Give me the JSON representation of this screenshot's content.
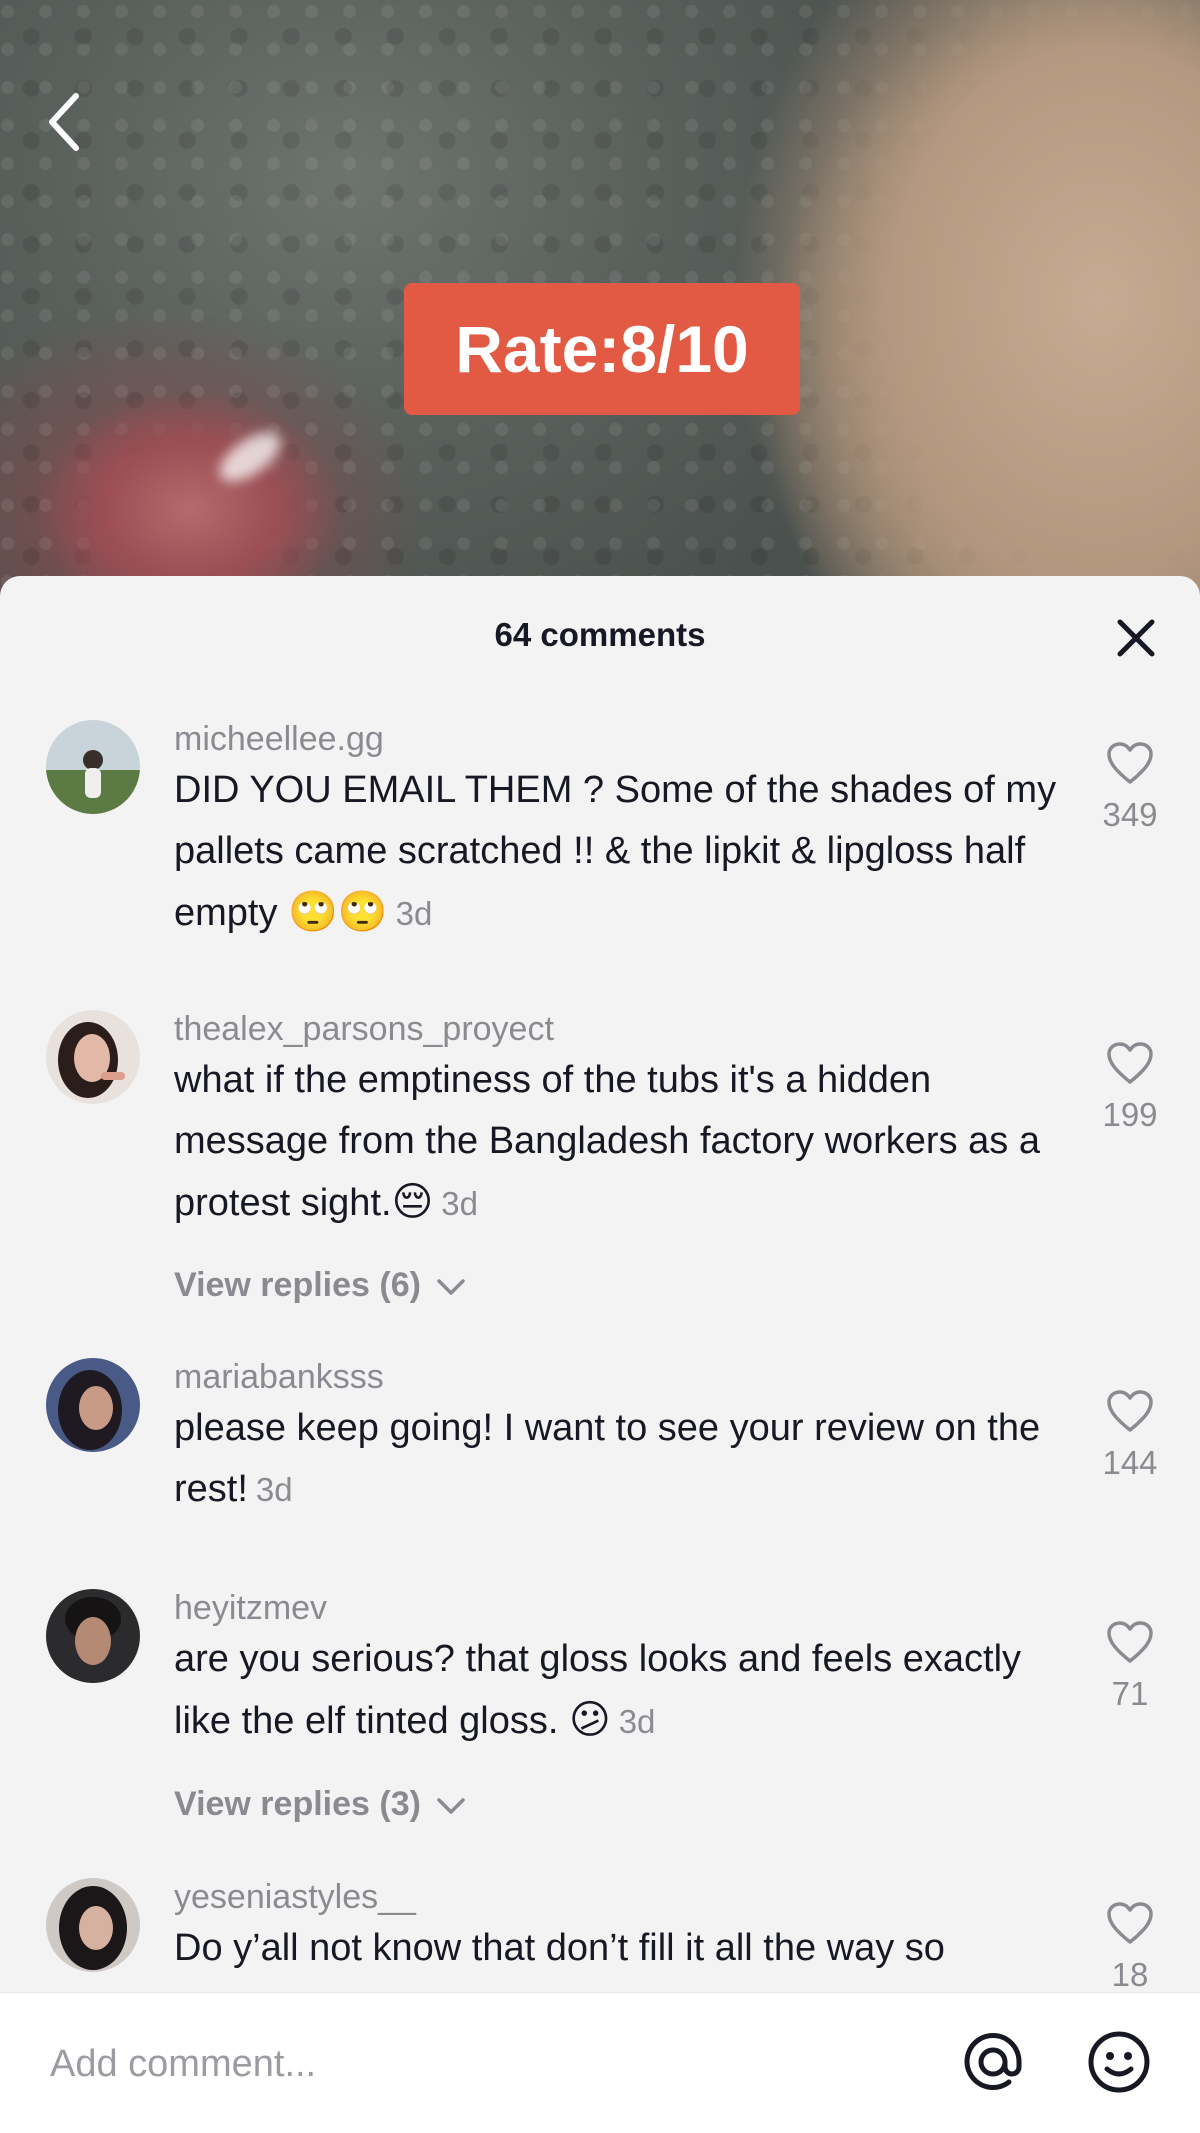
{
  "video": {
    "rate_label": "Rate:8/10"
  },
  "sheet": {
    "title": "64 comments"
  },
  "comments": [
    {
      "username": "micheellee.gg",
      "text": "DID YOU EMAIL THEM ? Some of the shades of my pallets came scratched !! & the lipkit & lipgloss half empty ",
      "emoji": "🙄🙄",
      "time": "3d",
      "likes": "349",
      "replies": ""
    },
    {
      "username": "thealex_parsons_proyect",
      "text": "what if the emptiness of the tubs it's a hidden message from the Bangladesh factory workers as a protest sight.",
      "emoji": "😔",
      "time": "3d",
      "likes": "199",
      "replies": "View replies (6)"
    },
    {
      "username": "mariabanksss",
      "text": "please keep going! I want to see your review on the rest!",
      "emoji": "",
      "time": "3d",
      "likes": "144",
      "replies": ""
    },
    {
      "username": "heyitzmev",
      "text": "are you serious? that gloss looks and feels exactly like the elf tinted gloss. ",
      "emoji": "😕",
      "time": "3d",
      "likes": "71",
      "replies": "View replies (3)"
    },
    {
      "username": "yeseniastyles__",
      "text": "Do y’all not know that don’t fill it all the way so",
      "emoji": "",
      "time": "",
      "likes": "18",
      "replies": ""
    }
  ],
  "input": {
    "placeholder": "Add comment..."
  },
  "icons": {
    "back": "chevron-left-icon",
    "close": "close-icon",
    "like": "heart-outline-icon",
    "mention": "at-sign-icon",
    "emoji": "smiley-icon"
  },
  "colors": {
    "accent_badge": "#e25a44",
    "sheet_bg": "#f4f3f4",
    "muted_text": "#8a8b91",
    "primary_text": "#161823"
  }
}
